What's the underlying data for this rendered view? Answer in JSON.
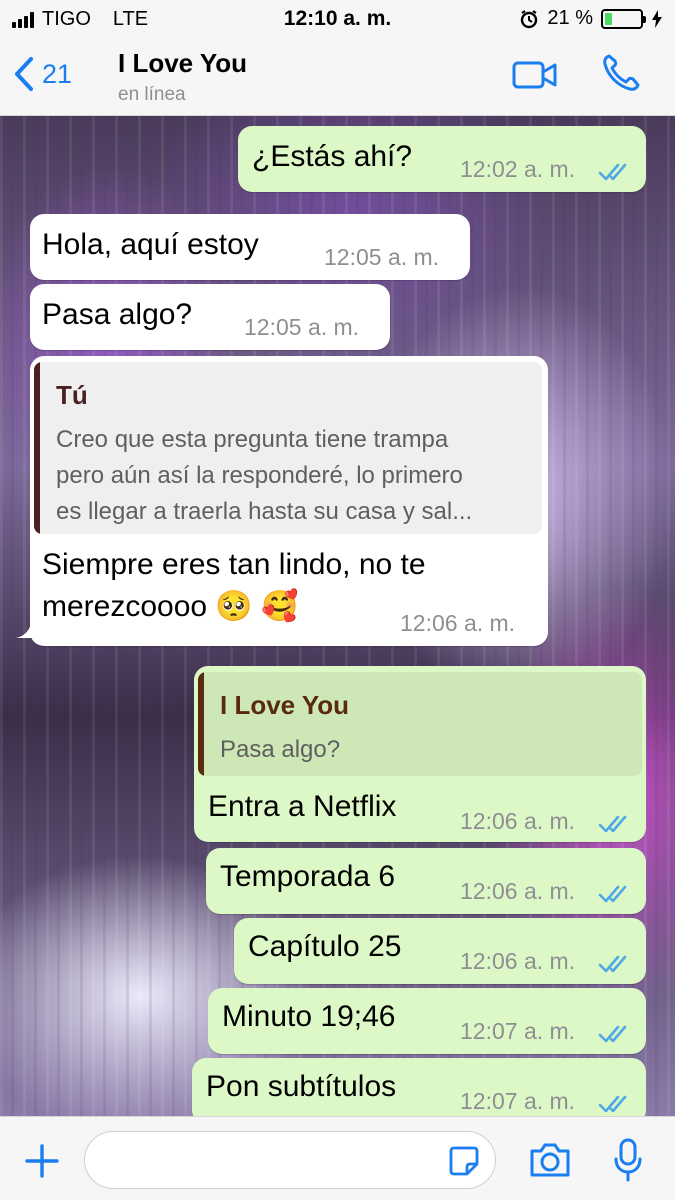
{
  "status_bar": {
    "carrier": "TIGO",
    "network": "LTE",
    "time": "12:10 a. m.",
    "battery": "21 %",
    "battery_level": 0.21
  },
  "header": {
    "back_count": "21",
    "contact_name": "I Love You",
    "status": "en línea"
  },
  "messages": [
    {
      "direction": "out",
      "text": "¿Estás ahí?",
      "time": "12:02 a. m.",
      "read": true
    },
    {
      "direction": "in",
      "text": "Hola, aquí estoy",
      "time": "12:05 a. m."
    },
    {
      "direction": "in",
      "text": "Pasa algo?",
      "time": "12:05 a. m."
    },
    {
      "direction": "in",
      "quote": {
        "author": "Tú",
        "lines": [
          "Creo que esta pregunta tiene trampa",
          "pero aún así la responderé, lo primero",
          "es llegar a traerla hasta su casa y sal..."
        ]
      },
      "text_lines": [
        "Siempre eres tan lindo, no te",
        "merezcoooo 🥺 🥰"
      ],
      "time": "12:06 a. m."
    },
    {
      "direction": "out",
      "quote": {
        "author": "I Love You",
        "lines": [
          "Pasa algo?"
        ]
      },
      "text": "Entra a Netflix",
      "time": "12:06 a. m.",
      "read": true
    },
    {
      "direction": "out",
      "text": "Temporada 6",
      "time": "12:06 a. m.",
      "read": true
    },
    {
      "direction": "out",
      "text": "Capítulo 25",
      "time": "12:06 a. m.",
      "read": true
    },
    {
      "direction": "out",
      "text": "Minuto 19;46",
      "time": "12:07 a. m.",
      "read": true
    },
    {
      "direction": "out",
      "text": "Pon subtítulos",
      "time": "12:07 a. m.",
      "read": true
    }
  ],
  "input_bar": {
    "add_icon": "plus-icon",
    "sticker_icon": "sticker-icon",
    "camera_icon": "camera-icon",
    "mic_icon": "microphone-icon"
  },
  "colors": {
    "accent": "#1a7ef0",
    "outgoing_bubble": "#dcf8c6",
    "incoming_bubble": "#ffffff",
    "read_ticks": "#4fa8e8",
    "quote_in_bar": "#4a2020",
    "quote_out_bar": "#5a2a10"
  }
}
